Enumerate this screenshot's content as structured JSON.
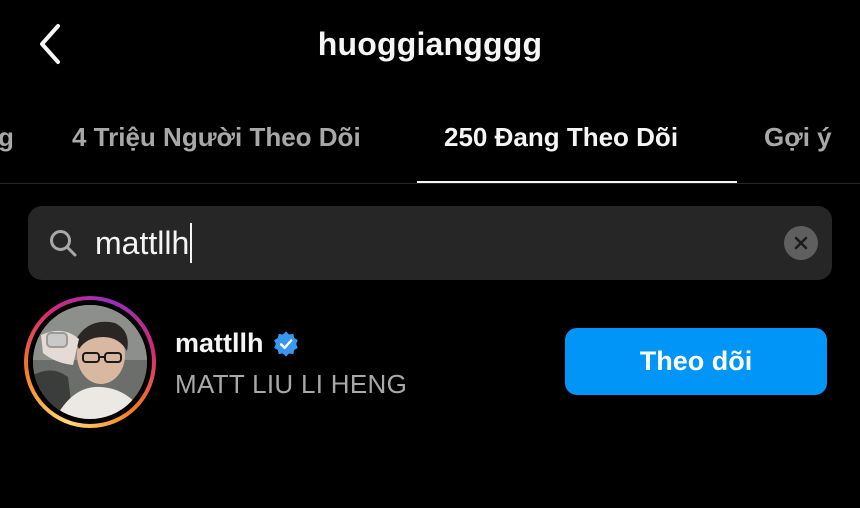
{
  "header": {
    "title": "huoggiangggg",
    "back_icon": "chevron-left-icon"
  },
  "tabs": [
    {
      "label": "g",
      "active": false
    },
    {
      "label": "4 Triệu Người Theo Dõi",
      "active": false
    },
    {
      "label": "250 Đang Theo Dõi",
      "active": true
    },
    {
      "label": "Gợi ý",
      "active": false
    }
  ],
  "search": {
    "icon": "search-icon",
    "value": "mattllh",
    "clear_icon": "clear-icon"
  },
  "results": [
    {
      "username": "mattllh",
      "verified": true,
      "full_name": "MATT LIU LI HENG",
      "follow_label": "Theo dõi"
    }
  ],
  "colors": {
    "background": "#000000",
    "primary_text": "#f5f5f5",
    "secondary_text": "#a8a8a8",
    "search_bg": "#262626",
    "follow_button": "#0095f6",
    "verified_badge": "#3897f0"
  }
}
